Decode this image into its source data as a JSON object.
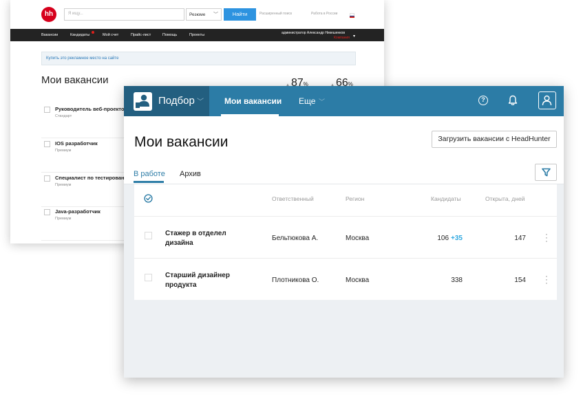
{
  "hh": {
    "logo": "hh",
    "search_placeholder": "Я ищу...",
    "search_type": "Резюме",
    "find_button": "Найти",
    "advanced_search": "Расширенный поиск",
    "work_abroad": "Работа в России",
    "nav": [
      "Вакансии",
      "Кандидаты",
      "Мой счет",
      "Прайс-лист",
      "Помощь",
      "Проекты"
    ],
    "admin_name": "администратор Александр Никешенков",
    "admin_sub": "Компания",
    "banner": "Купить это рекламное место на сайте",
    "title": "Мои вакансии",
    "stats": [
      {
        "value": "87",
        "unit": "%"
      },
      {
        "value": "66",
        "unit": "%"
      }
    ],
    "vacancies": [
      {
        "name": "Руководитель веб-проектов",
        "plan": "Стандарт"
      },
      {
        "name": "IOS разработчик",
        "plan": "Премиум"
      },
      {
        "name": "Специалист по тестированию",
        "plan": "Премиум"
      },
      {
        "name": "Java-разработчик",
        "plan": "Премиум"
      }
    ]
  },
  "app": {
    "brand": "Подбор",
    "tabs": {
      "vacancies": "Мои вакансии",
      "more": "Еще"
    },
    "icons": {
      "help": "?",
      "bell": "bell-icon",
      "user": "user-icon"
    },
    "title": "Мои вакансии",
    "import_button": "Загрузить вакансии с HeadHunter",
    "subtabs": {
      "active": "В работе",
      "archive": "Архив"
    },
    "columns": {
      "responsible": "Ответственный",
      "region": "Регион",
      "candidates": "Кандидаты",
      "open_days": "Открыта, дней"
    },
    "rows": [
      {
        "name": "Стажер в отделел дизайна",
        "responsible": "Бельтюкова А.",
        "region": "Москва",
        "candidates": "106",
        "candidates_new": "+35",
        "days": "147"
      },
      {
        "name": "Старший дизайнер продукта",
        "responsible": "Плотникова О.",
        "region": "Москва",
        "candidates": "338",
        "candidates_new": "",
        "days": "154"
      }
    ],
    "colors": {
      "header": "#2c7ca6",
      "brand_bg": "#235f80",
      "accent": "#2fa8e0"
    }
  }
}
